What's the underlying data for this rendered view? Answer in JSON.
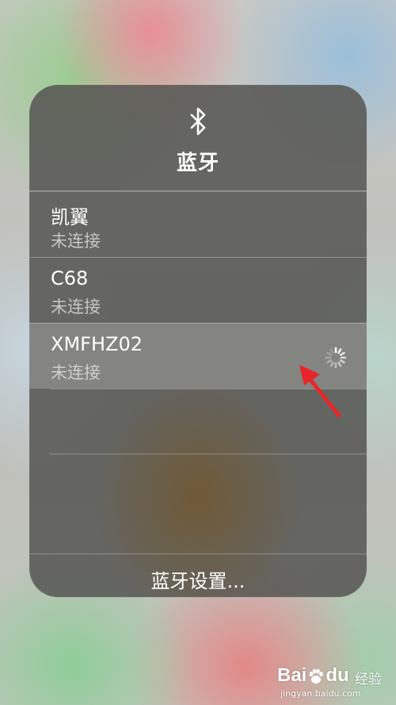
{
  "panel": {
    "title": "蓝牙",
    "header_icon": "bluetooth-icon",
    "settings_label": "蓝牙设置..."
  },
  "devices": [
    {
      "name": "凯翼",
      "status": "未连接",
      "connecting": false
    },
    {
      "name": "C68",
      "status": "未连接",
      "connecting": false
    },
    {
      "name": "XMFHZ02",
      "status": "未连接",
      "connecting": true
    }
  ],
  "annotation": {
    "arrow_icon": "red-arrow-icon",
    "color": "#e8262a"
  },
  "watermark": {
    "logo_prefix": "Bai",
    "logo_suffix": "du",
    "jingyan": "经验",
    "url": "jingyan.baidu.com"
  },
  "colors": {
    "panel_bg": "#58584f",
    "highlight_row": "#a5a5a3",
    "text_primary": "#ffffff",
    "text_secondary": "#c8c8c8"
  }
}
